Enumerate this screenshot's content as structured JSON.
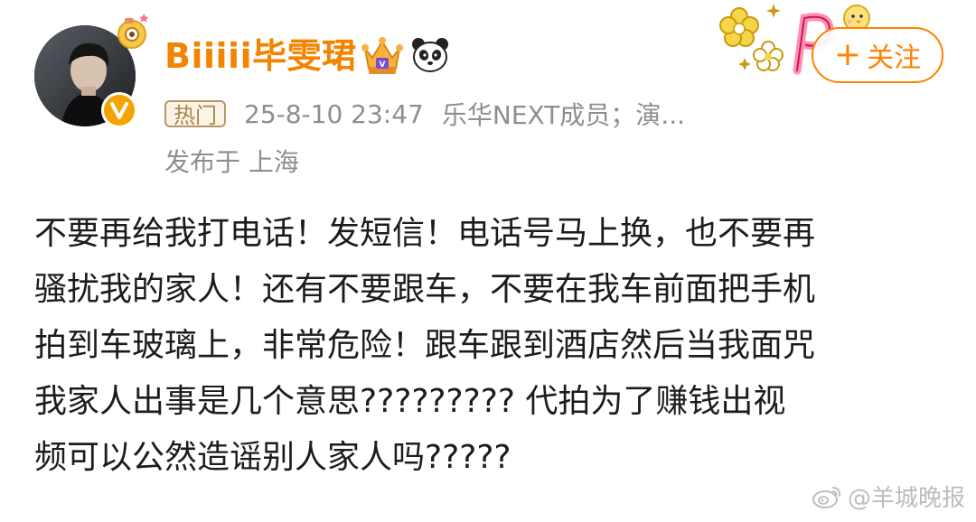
{
  "user": {
    "name": "Biiiii毕雯珺",
    "avatar_icon": "avatar-photo",
    "verified_icon": "verified-v-icon",
    "badges": [
      "crown-member-icon",
      "panda-icon"
    ]
  },
  "meta": {
    "hot_label": "热门",
    "time": "25-8-10 23:47",
    "description": "乐华NEXT成员；演...",
    "location": "发布于 上海"
  },
  "follow": {
    "plus": "+",
    "label": "关注"
  },
  "post": {
    "lines": [
      "不要再给我打电话！发短信！电话号马上换，也不要再",
      "骚扰我的家人！还有不要跟车，不要在我车前面把手机",
      "拍到车玻璃上，非常危险！跟车跟到酒店然后当我面咒",
      "我家人出事是几个意思????????? 代拍为了赚钱出视",
      "频可以公然造谣别人家人吗?????"
    ]
  },
  "watermark": {
    "text": "@羊城晚报",
    "icon": "weibo-logo-icon"
  },
  "colors": {
    "username": "#f28400",
    "follow": "#ff8200",
    "meta": "#8e8e8e",
    "text": "#1c1c1c"
  }
}
